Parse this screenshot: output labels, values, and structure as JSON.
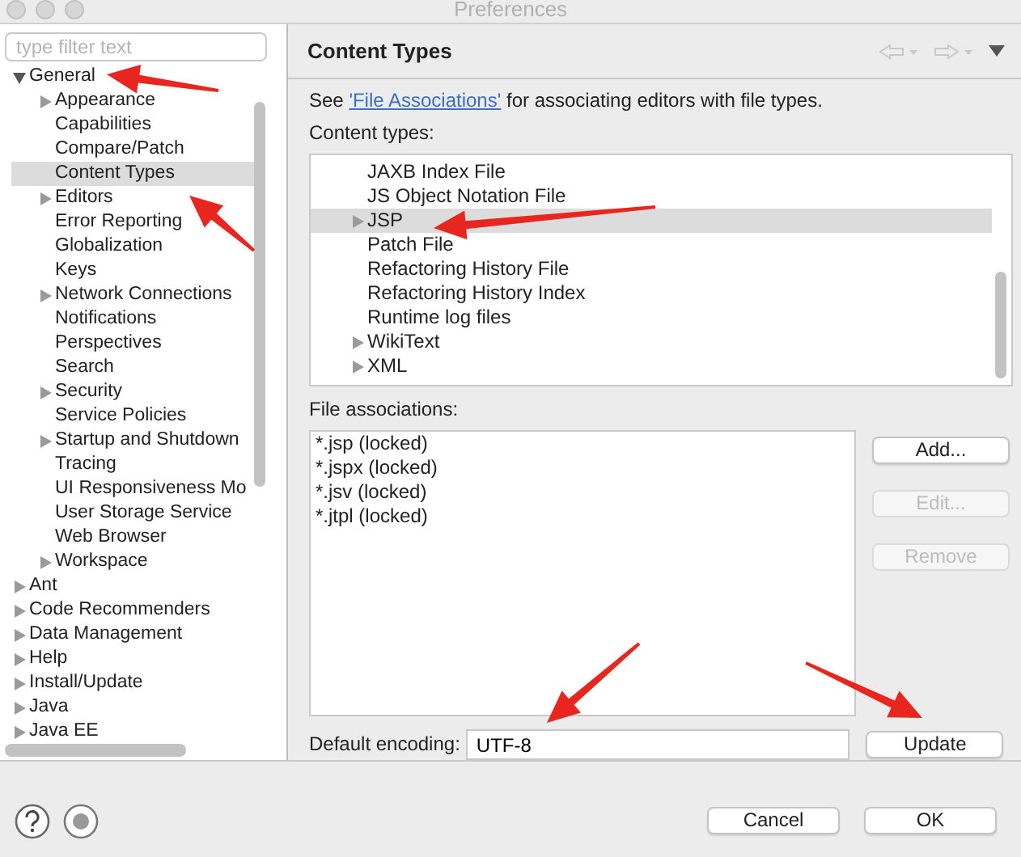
{
  "window": {
    "title": "Preferences"
  },
  "sidebar": {
    "filter": {
      "placeholder": "type filter text"
    },
    "items": [
      {
        "label": "General",
        "expandable": true,
        "expanded": true,
        "selected": false,
        "children": [
          {
            "label": "Appearance",
            "expandable": true,
            "expanded": false,
            "selected": false
          },
          {
            "label": "Capabilities",
            "expandable": false,
            "selected": false
          },
          {
            "label": "Compare/Patch",
            "expandable": false,
            "selected": false
          },
          {
            "label": "Content Types",
            "expandable": false,
            "selected": true
          },
          {
            "label": "Editors",
            "expandable": true,
            "expanded": false,
            "selected": false
          },
          {
            "label": "Error Reporting",
            "expandable": false,
            "selected": false
          },
          {
            "label": "Globalization",
            "expandable": false,
            "selected": false
          },
          {
            "label": "Keys",
            "expandable": false,
            "selected": false
          },
          {
            "label": "Network Connections",
            "expandable": true,
            "expanded": false,
            "selected": false
          },
          {
            "label": "Notifications",
            "expandable": false,
            "selected": false
          },
          {
            "label": "Perspectives",
            "expandable": false,
            "selected": false
          },
          {
            "label": "Search",
            "expandable": false,
            "selected": false
          },
          {
            "label": "Security",
            "expandable": true,
            "expanded": false,
            "selected": false
          },
          {
            "label": "Service Policies",
            "expandable": false,
            "selected": false
          },
          {
            "label": "Startup and Shutdown",
            "expandable": true,
            "expanded": false,
            "selected": false
          },
          {
            "label": "Tracing",
            "expandable": false,
            "selected": false
          },
          {
            "label": "UI Responsiveness Mo",
            "expandable": false,
            "selected": false
          },
          {
            "label": "User Storage Service",
            "expandable": false,
            "selected": false
          },
          {
            "label": "Web Browser",
            "expandable": false,
            "selected": false
          },
          {
            "label": "Workspace",
            "expandable": true,
            "expanded": false,
            "selected": false
          }
        ]
      },
      {
        "label": "Ant",
        "expandable": true,
        "expanded": false,
        "selected": false
      },
      {
        "label": "Code Recommenders",
        "expandable": true,
        "expanded": false,
        "selected": false
      },
      {
        "label": "Data Management",
        "expandable": true,
        "expanded": false,
        "selected": false
      },
      {
        "label": "Help",
        "expandable": true,
        "expanded": false,
        "selected": false
      },
      {
        "label": "Install/Update",
        "expandable": true,
        "expanded": false,
        "selected": false
      },
      {
        "label": "Java",
        "expandable": true,
        "expanded": false,
        "selected": false
      },
      {
        "label": "Java EE",
        "expandable": true,
        "expanded": false,
        "selected": false
      }
    ]
  },
  "page": {
    "title": "Content Types",
    "intro": {
      "before": "See ",
      "link": "'File Associations'",
      "after": " for associating editors with file types."
    },
    "content_types_label": "Content types:",
    "content_types": [
      {
        "label": "JAXB Index File",
        "expandable": false,
        "selected": false
      },
      {
        "label": "JS Object Notation File",
        "expandable": false,
        "selected": false
      },
      {
        "label": "JSP",
        "expandable": true,
        "expanded": false,
        "selected": true
      },
      {
        "label": "Patch File",
        "expandable": false,
        "selected": false
      },
      {
        "label": "Refactoring History File",
        "expandable": false,
        "selected": false
      },
      {
        "label": "Refactoring History Index",
        "expandable": false,
        "selected": false
      },
      {
        "label": "Runtime log files",
        "expandable": false,
        "selected": false
      },
      {
        "label": "WikiText",
        "expandable": true,
        "expanded": false,
        "selected": false
      },
      {
        "label": "XML",
        "expandable": true,
        "expanded": false,
        "selected": false
      }
    ],
    "file_associations_label": "File associations:",
    "file_associations": [
      "*.jsp (locked)",
      "*.jspx (locked)",
      "*.jsv (locked)",
      "*.jtpl (locked)"
    ],
    "side_buttons": [
      {
        "label": "Add...",
        "disabled": false
      },
      {
        "label": "Edit...",
        "disabled": true
      },
      {
        "label": "Remove",
        "disabled": true
      }
    ],
    "encoding": {
      "label": "Default encoding:",
      "value": "UTF-8"
    },
    "update_button": "Update"
  },
  "footer_buttons": [
    "Cancel",
    "OK"
  ]
}
